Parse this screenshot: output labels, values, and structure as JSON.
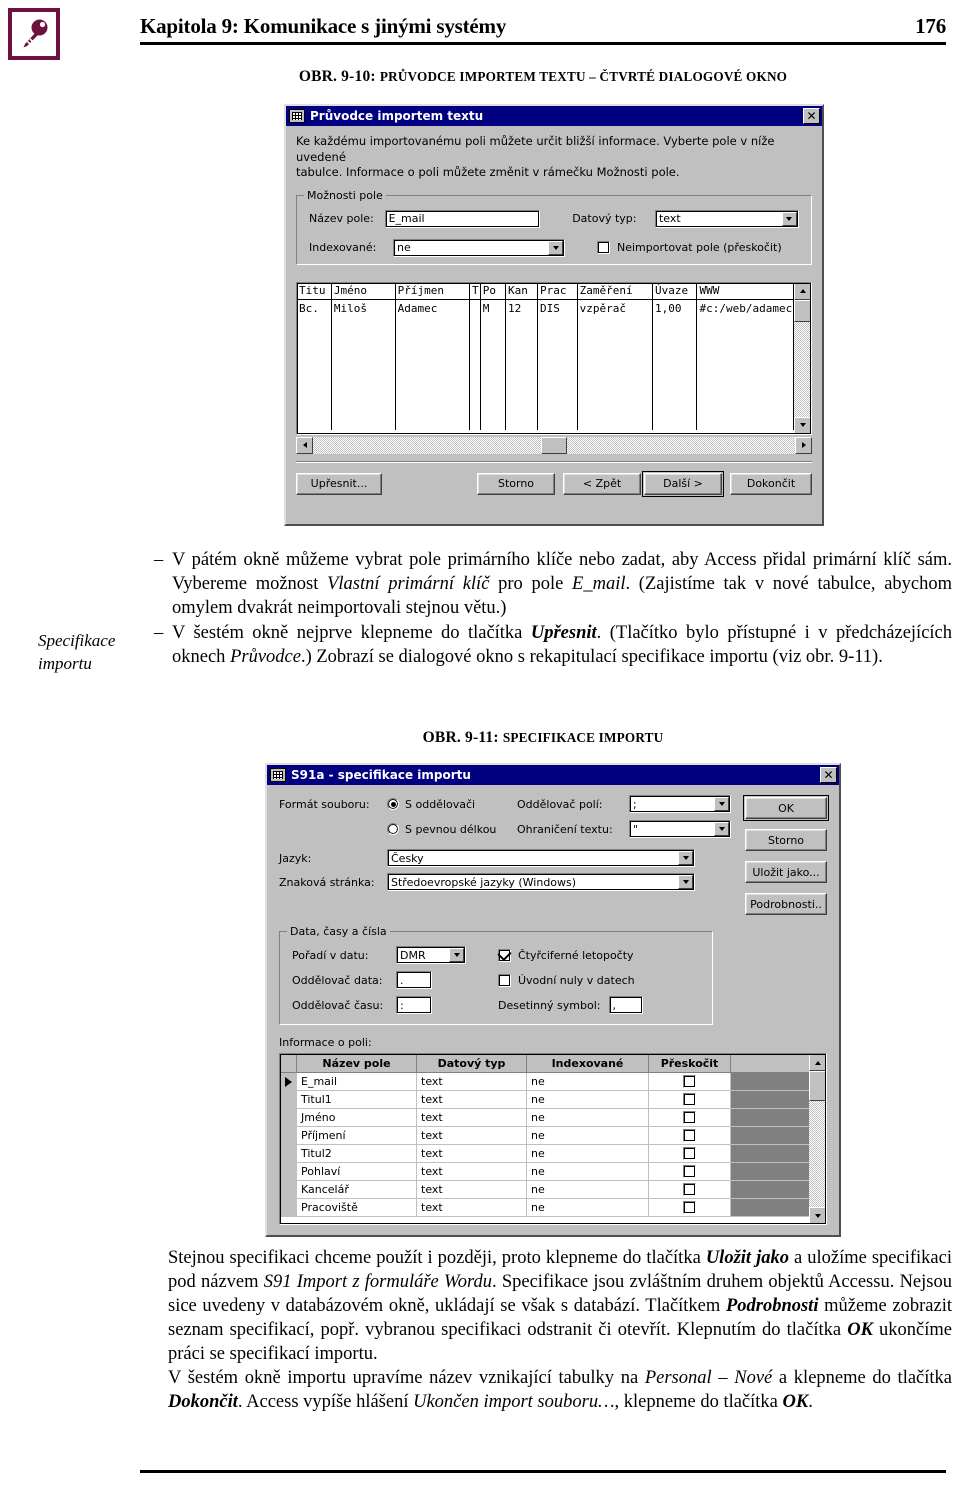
{
  "page": {
    "header_title": "Kapitola 9: Komunikace s jinými systémy",
    "page_number": "176",
    "logo_name": "key-logo",
    "logo_color": "#6d1240"
  },
  "figure1": {
    "caption_prefix": "OBR. 9-10: ",
    "caption_text": "PRŮVODCE IMPORTEM TEXTU – ČTVRTÉ DIALOGOVÉ OKNO",
    "dialog": {
      "title": "Průvodce importem textu",
      "close_label": "✕",
      "instructions_line1": "Ke každému importovanému poli můžete určit bližší informace. Vyberte pole v níže uvedené",
      "instructions_line2": "tabulce. Informace o poli můžete změnit v rámečku Možnosti pole.",
      "group_title": "Možnosti pole",
      "field_name_label": "Název pole:",
      "field_name_value": "E_mail",
      "data_type_label": "Datový typ:",
      "data_type_value": "text",
      "indexed_label": "Indexované:",
      "indexed_value": "ne",
      "skip_checkbox_label": "Neimportovat pole (přeskočit)",
      "skip_checkbox_checked": false,
      "preview": {
        "headers": [
          "Titu",
          "Jméno",
          "Příjmen",
          "T",
          "Po",
          "Kan",
          "Prac",
          "Zaměření",
          "Úvaze",
          "WWW"
        ],
        "rows": [
          [
            "Bc.",
            "Miloš",
            "Adamec",
            "",
            "M",
            "12",
            "DIS",
            "vzpěrač",
            "1,00",
            "#c:/web/adamec/"
          ]
        ]
      },
      "buttons": {
        "advanced": "Upřesnit...",
        "cancel": "Storno",
        "back": "< Zpět",
        "next": "Další >",
        "finish": "Dokončit"
      }
    }
  },
  "para1": {
    "items": [
      "V pátém okně můžeme vybrat pole primárního klíče nebo zadat, aby Access přidal primární klíč sám. Vybereme možnost <i>Vlastní primární klíč</i> pro pole <i>E_mail</i>. (Zajistíme tak v nové tabulce, abychom omylem dvakrát neimportovali stejnou větu.)",
      "V šestém okně nejprve klepneme do tlačítka <b><i>Upřesnit</i></b>. (Tlačítko bylo přístupné i v předcházejících oknech <i>Průvodce</i>.) Zobrazí se dialogové okno s rekapitulací specifikace importu (viz obr. 9-11)."
    ]
  },
  "margin_note": {
    "line1": "Specifikace",
    "line2": "importu"
  },
  "figure2": {
    "caption_prefix": "OBR. 9-11: ",
    "caption_text": "SPECIFIKACE IMPORTU",
    "dialog": {
      "title": "S91a  - specifikace importu",
      "close_label": "✕",
      "file_format_label": "Formát souboru:",
      "radio_delimited": "S oddělovači",
      "radio_delimited_selected": true,
      "radio_fixed": "S pevnou délkou",
      "radio_fixed_selected": false,
      "field_sep_label": "Oddělovač polí:",
      "field_sep_value": ";",
      "text_qual_label": "Ohraničení textu:",
      "text_qual_value": "\"",
      "language_label": "Jazyk:",
      "language_value": "Česky",
      "codepage_label": "Znaková stránka:",
      "codepage_value": "Středoevropské jazyky (Windows)",
      "dates_group_title": "Data, časy a čísla",
      "date_order_label": "Pořadí v datu:",
      "date_order_value": "DMR",
      "date_sep_label": "Oddělovač data:",
      "date_sep_value": ".",
      "time_sep_label": "Oddělovač času:",
      "time_sep_value": ":",
      "four_digit_label": "Čtyřciferné letopočty",
      "four_digit_checked": true,
      "leading_zeros_label": "Úvodní nuly v datech",
      "leading_zeros_checked": false,
      "decimal_label": "Desetinný symbol:",
      "decimal_value": ",",
      "field_info_label": "Informace o poli:",
      "grid_headers": [
        "Název pole",
        "Datový typ",
        "Indexované",
        "Přeskočit"
      ],
      "grid_rows": [
        {
          "name": "E_mail",
          "type": "text",
          "indexed": "ne",
          "skip": false,
          "current": true
        },
        {
          "name": "Titul1",
          "type": "text",
          "indexed": "ne",
          "skip": false,
          "current": false
        },
        {
          "name": "Jméno",
          "type": "text",
          "indexed": "ne",
          "skip": false,
          "current": false
        },
        {
          "name": "Příjmení",
          "type": "text",
          "indexed": "ne",
          "skip": false,
          "current": false
        },
        {
          "name": "Titul2",
          "type": "text",
          "indexed": "ne",
          "skip": false,
          "current": false
        },
        {
          "name": "Pohlaví",
          "type": "text",
          "indexed": "ne",
          "skip": false,
          "current": false
        },
        {
          "name": "Kancelář",
          "type": "text",
          "indexed": "ne",
          "skip": false,
          "current": false
        },
        {
          "name": "Pracoviště",
          "type": "text",
          "indexed": "ne",
          "skip": false,
          "current": false
        }
      ],
      "buttons": {
        "ok": "OK",
        "cancel": "Storno",
        "save_as": "Uložit jako...",
        "details": "Podrobnosti.."
      }
    }
  },
  "para2": {
    "html": "Stejnou specifikaci chceme použít i později, proto klepneme do tlačítka <b><i>Uložit jako</i></b> a uložíme specifikaci pod názvem <i>S91 Import z formuláře Wordu</i>. Specifikace jsou zvláštním druhem objektů Accessu. Nejsou sice uvedeny v databázovém okně, ukládají se však s databází. Tlačítkem <b><i>Podrobnosti</i></b> můžeme zobrazit seznam specifikací, popř. vybranou specifikaci odstranit či otevřít. Klepnutím do tlačítka <b><i>OK</i></b> ukončíme práci se specifikací importu."
  },
  "para3": {
    "html": "V šestém okně importu upravíme název vznikající tabulky na <i>Personal – Nové</i> a klepneme do tlačítka <b><i>Dokončit</i></b>. Access vypíše hlášení <i>Ukončen import souboru…</i>, klepneme do tlačítka <b><i>OK</i></b>."
  }
}
